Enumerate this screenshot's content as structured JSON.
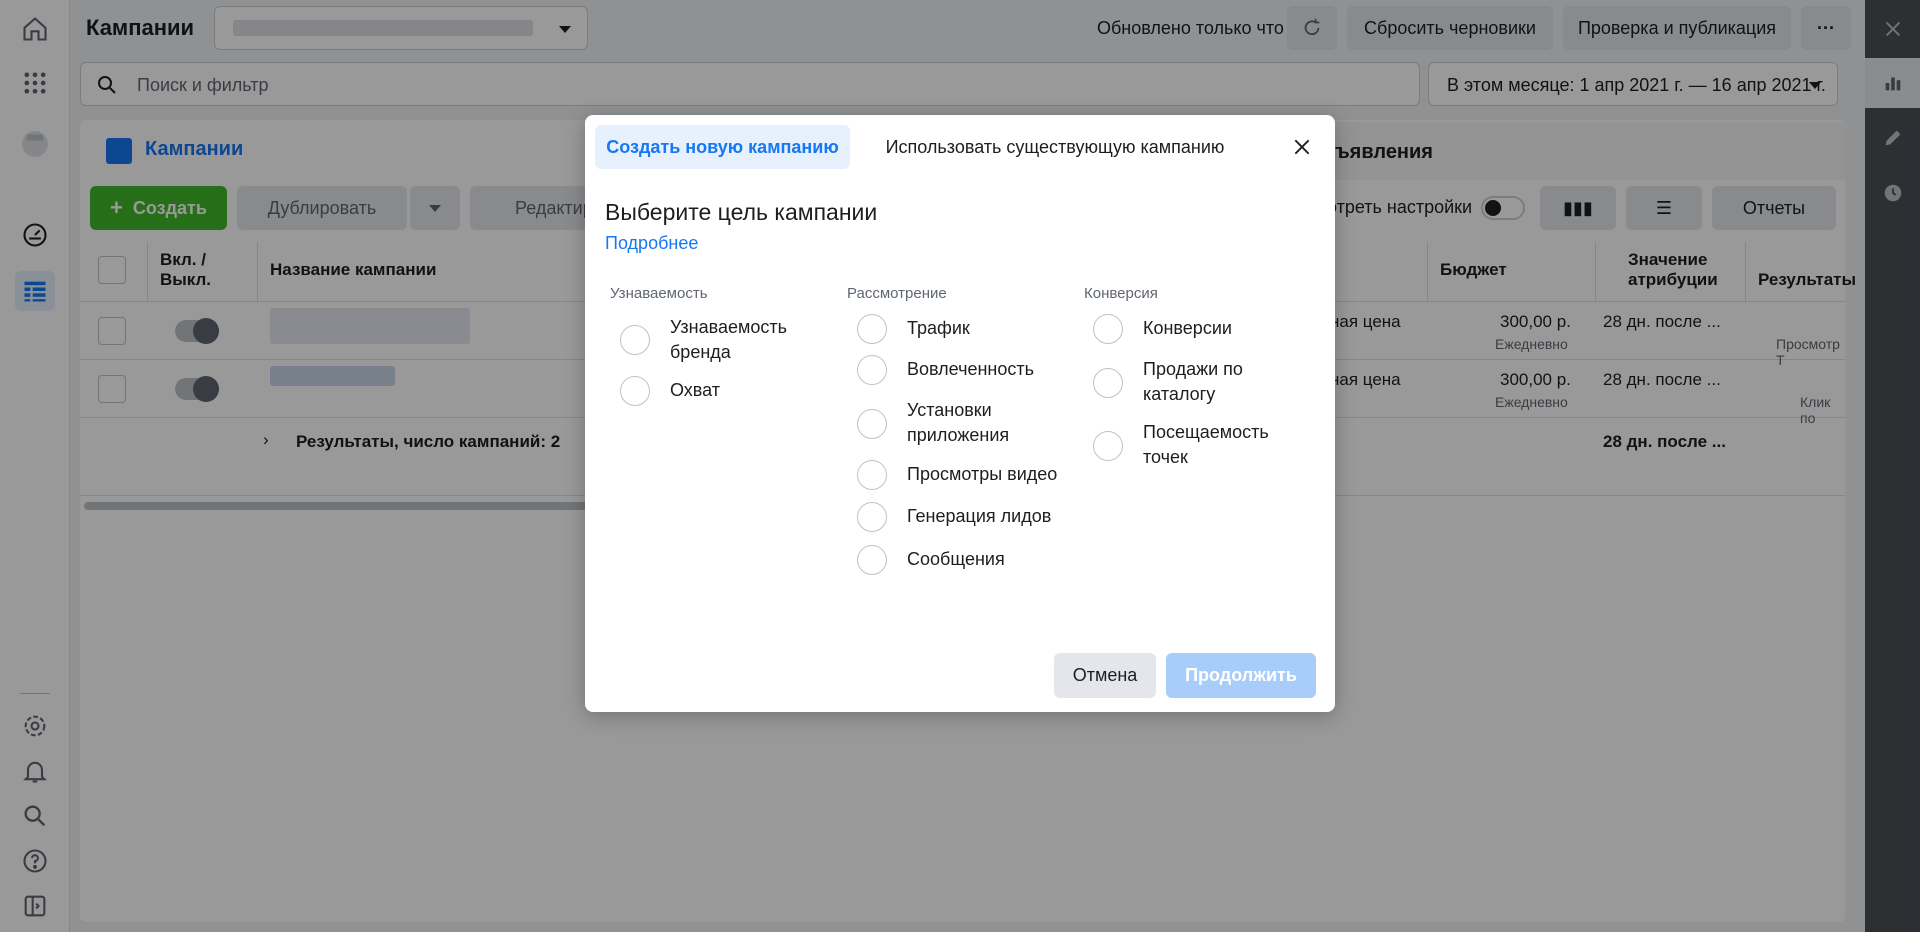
{
  "topbar": {
    "title": "Кампании",
    "updated": "Обновлено только что",
    "discard_drafts": "Сбросить черновики",
    "review_publish": "Проверка и публикация",
    "more": "···"
  },
  "search": {
    "placeholder": "Поиск и фильтр",
    "date_range": "В этом месяце: 1 апр 2021 г. — 16 апр 2021 г."
  },
  "tabs": {
    "campaigns": "Кампании",
    "ads": "бъявления"
  },
  "toolbar": {
    "create": "Создать",
    "duplicate": "Дублировать",
    "edit": "Редактир",
    "view_settings": "отреть настройки",
    "reports": "Отчеты"
  },
  "table": {
    "headers": {
      "onoff": "Вкл. / Выкл.",
      "name": "Название кампании",
      "budget": "Бюджет",
      "attribution": "Значение атрибуции",
      "results": "Результаты"
    },
    "rows": [
      {
        "bid": "ная цена",
        "budget": "300,00 р.",
        "budget_period": "Ежедневно",
        "attribution": "28 дн. после ...",
        "results_sub": "Просмотр Т"
      },
      {
        "bid": "ная цена",
        "budget": "300,00 р.",
        "budget_period": "Ежедневно",
        "attribution": "28 дн. после ...",
        "results_sub": "Клик по"
      }
    ],
    "summary": {
      "label": "Результаты, число кампаний: 2",
      "attribution": "28 дн. после ..."
    }
  },
  "modal": {
    "tab_new": "Создать новую кампанию",
    "tab_existing": "Использовать существующую кампанию",
    "heading": "Выберите цель кампании",
    "learn_more": "Подробнее",
    "columns": [
      {
        "title": "Узнаваемость",
        "options": [
          "Узнаваемость бренда",
          "Охват"
        ]
      },
      {
        "title": "Рассмотрение",
        "options": [
          "Трафик",
          "Вовлеченность",
          "Установки приложения",
          "Просмотры видео",
          "Генерация лидов",
          "Сообщения"
        ]
      },
      {
        "title": "Конверсия",
        "options": [
          "Конверсии",
          "Продажи по каталогу",
          "Посещаемость точек"
        ]
      }
    ],
    "cancel": "Отмена",
    "continue": "Продолжить"
  },
  "colors": {
    "accent": "#1877f2",
    "create_green": "#42b72a",
    "continue_disabled": "#a8cdfb",
    "overlay": "rgba(0,0,0,0.4)"
  }
}
